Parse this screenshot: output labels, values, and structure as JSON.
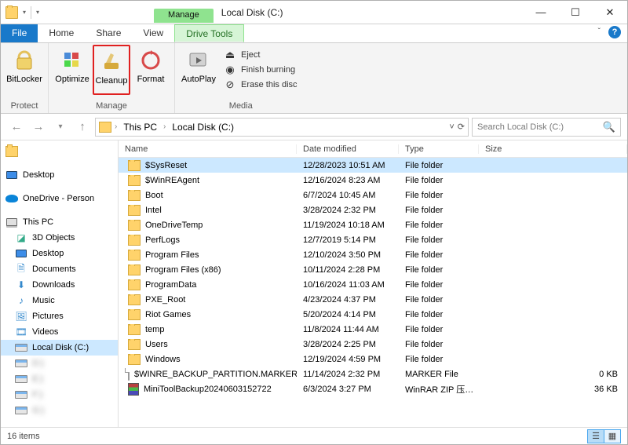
{
  "window": {
    "title": "Local Disk (C:)",
    "context_tab": "Manage"
  },
  "ribbon_tabs": {
    "file": "File",
    "home": "Home",
    "share": "Share",
    "view": "View",
    "drive_tools": "Drive Tools"
  },
  "ribbon": {
    "protect": {
      "bitlocker": "BitLocker",
      "group": "Protect"
    },
    "manage": {
      "optimize": "Optimize",
      "cleanup": "Cleanup",
      "format": "Format",
      "group": "Manage"
    },
    "media": {
      "autoplay": "AutoPlay",
      "eject": "Eject",
      "finish": "Finish burning",
      "erase": "Erase this disc",
      "group": "Media"
    }
  },
  "address": {
    "root": "This PC",
    "loc": "Local Disk (C:)"
  },
  "search": {
    "placeholder": "Search Local Disk (C:)"
  },
  "nav": {
    "desktop": "Desktop",
    "onedrive": "OneDrive - Person",
    "thispc": "This PC",
    "obj3d": "3D Objects",
    "desktop2": "Desktop",
    "documents": "Documents",
    "downloads": "Downloads",
    "music": "Music",
    "pictures": "Pictures",
    "videos": "Videos",
    "cdrive": "Local Disk (C:)",
    "d": "D:)",
    "e": "E:)",
    "f": "F:)",
    "g": "G:)"
  },
  "columns": {
    "name": "Name",
    "date": "Date modified",
    "type": "Type",
    "size": "Size"
  },
  "files": [
    {
      "name": "$SysReset",
      "date": "12/28/2023 10:51 AM",
      "type": "File folder",
      "size": "",
      "icon": "folder",
      "sel": true
    },
    {
      "name": "$WinREAgent",
      "date": "12/16/2024 8:23 AM",
      "type": "File folder",
      "size": "",
      "icon": "folder"
    },
    {
      "name": "Boot",
      "date": "6/7/2024 10:45 AM",
      "type": "File folder",
      "size": "",
      "icon": "folder"
    },
    {
      "name": "Intel",
      "date": "3/28/2024 2:32 PM",
      "type": "File folder",
      "size": "",
      "icon": "folder"
    },
    {
      "name": "OneDriveTemp",
      "date": "11/19/2024 10:18 AM",
      "type": "File folder",
      "size": "",
      "icon": "folder"
    },
    {
      "name": "PerfLogs",
      "date": "12/7/2019 5:14 PM",
      "type": "File folder",
      "size": "",
      "icon": "folder"
    },
    {
      "name": "Program Files",
      "date": "12/10/2024 3:50 PM",
      "type": "File folder",
      "size": "",
      "icon": "folder"
    },
    {
      "name": "Program Files (x86)",
      "date": "10/11/2024 2:28 PM",
      "type": "File folder",
      "size": "",
      "icon": "folder"
    },
    {
      "name": "ProgramData",
      "date": "10/16/2024 11:03 AM",
      "type": "File folder",
      "size": "",
      "icon": "folder"
    },
    {
      "name": "PXE_Root",
      "date": "4/23/2024 4:37 PM",
      "type": "File folder",
      "size": "",
      "icon": "folder"
    },
    {
      "name": "Riot Games",
      "date": "5/20/2024 4:14 PM",
      "type": "File folder",
      "size": "",
      "icon": "folder"
    },
    {
      "name": "temp",
      "date": "11/8/2024 11:44 AM",
      "type": "File folder",
      "size": "",
      "icon": "folder"
    },
    {
      "name": "Users",
      "date": "3/28/2024 2:25 PM",
      "type": "File folder",
      "size": "",
      "icon": "folder"
    },
    {
      "name": "Windows",
      "date": "12/19/2024 4:59 PM",
      "type": "File folder",
      "size": "",
      "icon": "folder"
    },
    {
      "name": "$WINRE_BACKUP_PARTITION.MARKER",
      "date": "11/14/2024 2:32 PM",
      "type": "MARKER File",
      "size": "0 KB",
      "icon": "file"
    },
    {
      "name": "MiniToolBackup20240603152722",
      "date": "6/3/2024 3:27 PM",
      "type": "WinRAR ZIP 压缩…",
      "size": "36 KB",
      "icon": "rar"
    }
  ],
  "status": {
    "items": "16 items"
  }
}
